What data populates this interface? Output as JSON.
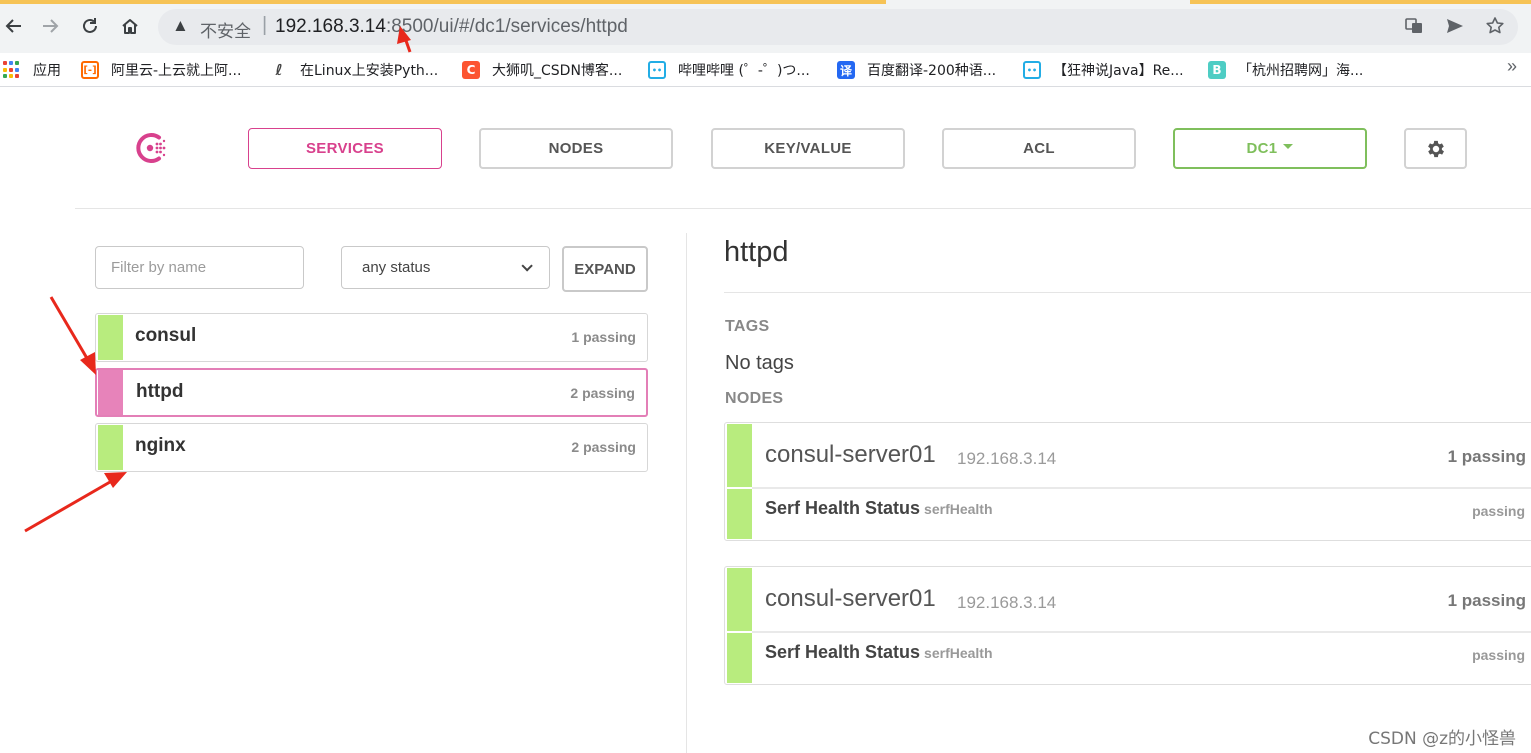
{
  "browser": {
    "security_label": "不安全",
    "url_host": "192.168.3.14",
    "url_rest": ":8500/ui/#/dc1/services/httpd",
    "bookmarks": [
      {
        "label": "应用",
        "icon": "apps-grid-icon"
      },
      {
        "label": "阿里云-上云就上阿...",
        "icon": "aliyun-icon",
        "color": "#ff6a00"
      },
      {
        "label": "在Linux上安装Pyth...",
        "icon": "linux-icon",
        "color": "#444444"
      },
      {
        "label": "大狮叽_CSDN博客...",
        "icon": "csdn-icon",
        "color": "#fc5531"
      },
      {
        "label": "哔哩哔哩 (゜-゜)つ...",
        "icon": "bilibili-icon",
        "color": "#23ade5"
      },
      {
        "label": "百度翻译-200种语...",
        "icon": "baidu-translate-icon",
        "color": "#2468f2",
        "glyph": "译"
      },
      {
        "label": "【狂神说Java】Re...",
        "icon": "bilibili-icon",
        "color": "#23ade5"
      },
      {
        "label": "「杭州招聘网」海...",
        "icon": "b-icon",
        "color": "#4ecdc4",
        "glyph": "B"
      }
    ]
  },
  "nav": {
    "services": "SERVICES",
    "nodes": "NODES",
    "keyvalue": "KEY/VALUE",
    "acl": "ACL",
    "datacenter": "DC1"
  },
  "filter": {
    "placeholder": "Filter by name",
    "status_selected": "any status",
    "expand_label": "EXPAND"
  },
  "services": [
    {
      "name": "consul",
      "status": "1 passing",
      "selected": false
    },
    {
      "name": "httpd",
      "status": "2 passing",
      "selected": true
    },
    {
      "name": "nginx",
      "status": "2 passing",
      "selected": false
    }
  ],
  "detail": {
    "title": "httpd",
    "tags_label": "TAGS",
    "tags_value": "No tags",
    "nodes_label": "NODES",
    "nodes": [
      {
        "name": "consul-server01",
        "address": "192.168.3.14",
        "status": "1 passing",
        "check_name": "Serf Health Status",
        "check_id": "serfHealth",
        "check_status": "passing"
      },
      {
        "name": "consul-server01",
        "address": "192.168.3.14",
        "status": "1 passing",
        "check_name": "Serf Health Status",
        "check_id": "serfHealth",
        "check_status": "passing"
      }
    ]
  },
  "colors": {
    "accent_pink": "#d8418d",
    "passing_green": "#b8ec7e",
    "dc_green": "#7fbf5c",
    "annotation_red": "#e8281c"
  },
  "watermark": "CSDN @z的小怪兽"
}
